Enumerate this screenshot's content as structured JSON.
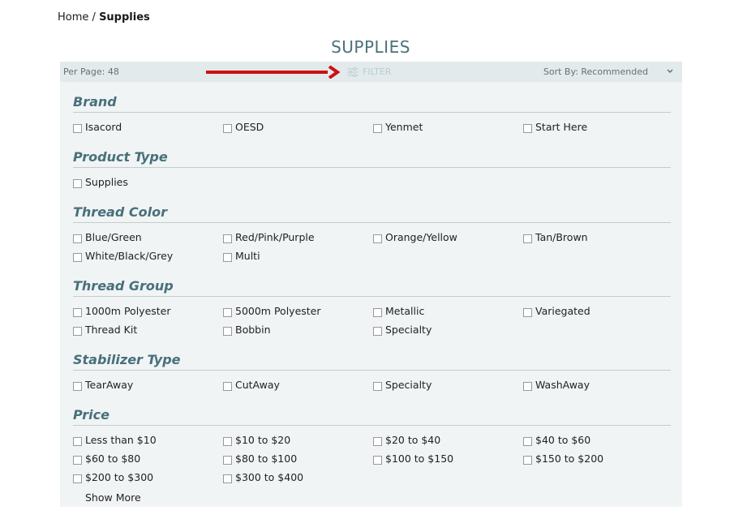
{
  "breadcrumb": {
    "home": "Home",
    "separator": "/",
    "current": "Supplies"
  },
  "page_title": "SUPPLIES",
  "toolbar": {
    "per_page": "Per Page: 48",
    "filter_label": "FILTER",
    "sort_label": "Sort By: Recommended"
  },
  "colors": {
    "accent": "#48707a",
    "panel_bg": "#f0f4f5",
    "toolbar_bg": "#e3eaec",
    "annotation_arrow": "#cc1111"
  },
  "sections": [
    {
      "title": "Brand",
      "options": [
        "Isacord",
        "OESD",
        "Yenmet",
        "Start Here"
      ]
    },
    {
      "title": "Product Type",
      "options": [
        "Supplies"
      ]
    },
    {
      "title": "Thread Color",
      "options": [
        "Blue/Green",
        "Red/Pink/Purple",
        "Orange/Yellow",
        "Tan/Brown",
        "White/Black/Grey",
        "Multi"
      ]
    },
    {
      "title": "Thread Group",
      "options": [
        "1000m Polyester",
        "5000m Polyester",
        "Metallic",
        "Variegated",
        "Thread Kit",
        "Bobbin",
        "Specialty"
      ]
    },
    {
      "title": "Stabilizer Type",
      "options": [
        "TearAway",
        "CutAway",
        "Specialty",
        "WashAway"
      ]
    },
    {
      "title": "Price",
      "options": [
        "Less than $10",
        "$10 to $20",
        "$20 to $40",
        "$40 to $60",
        "$60 to $80",
        "$80 to $100",
        "$100 to $150",
        "$150 to $200",
        "$200 to $300",
        "$300 to $400"
      ]
    }
  ],
  "show_more": "Show More"
}
